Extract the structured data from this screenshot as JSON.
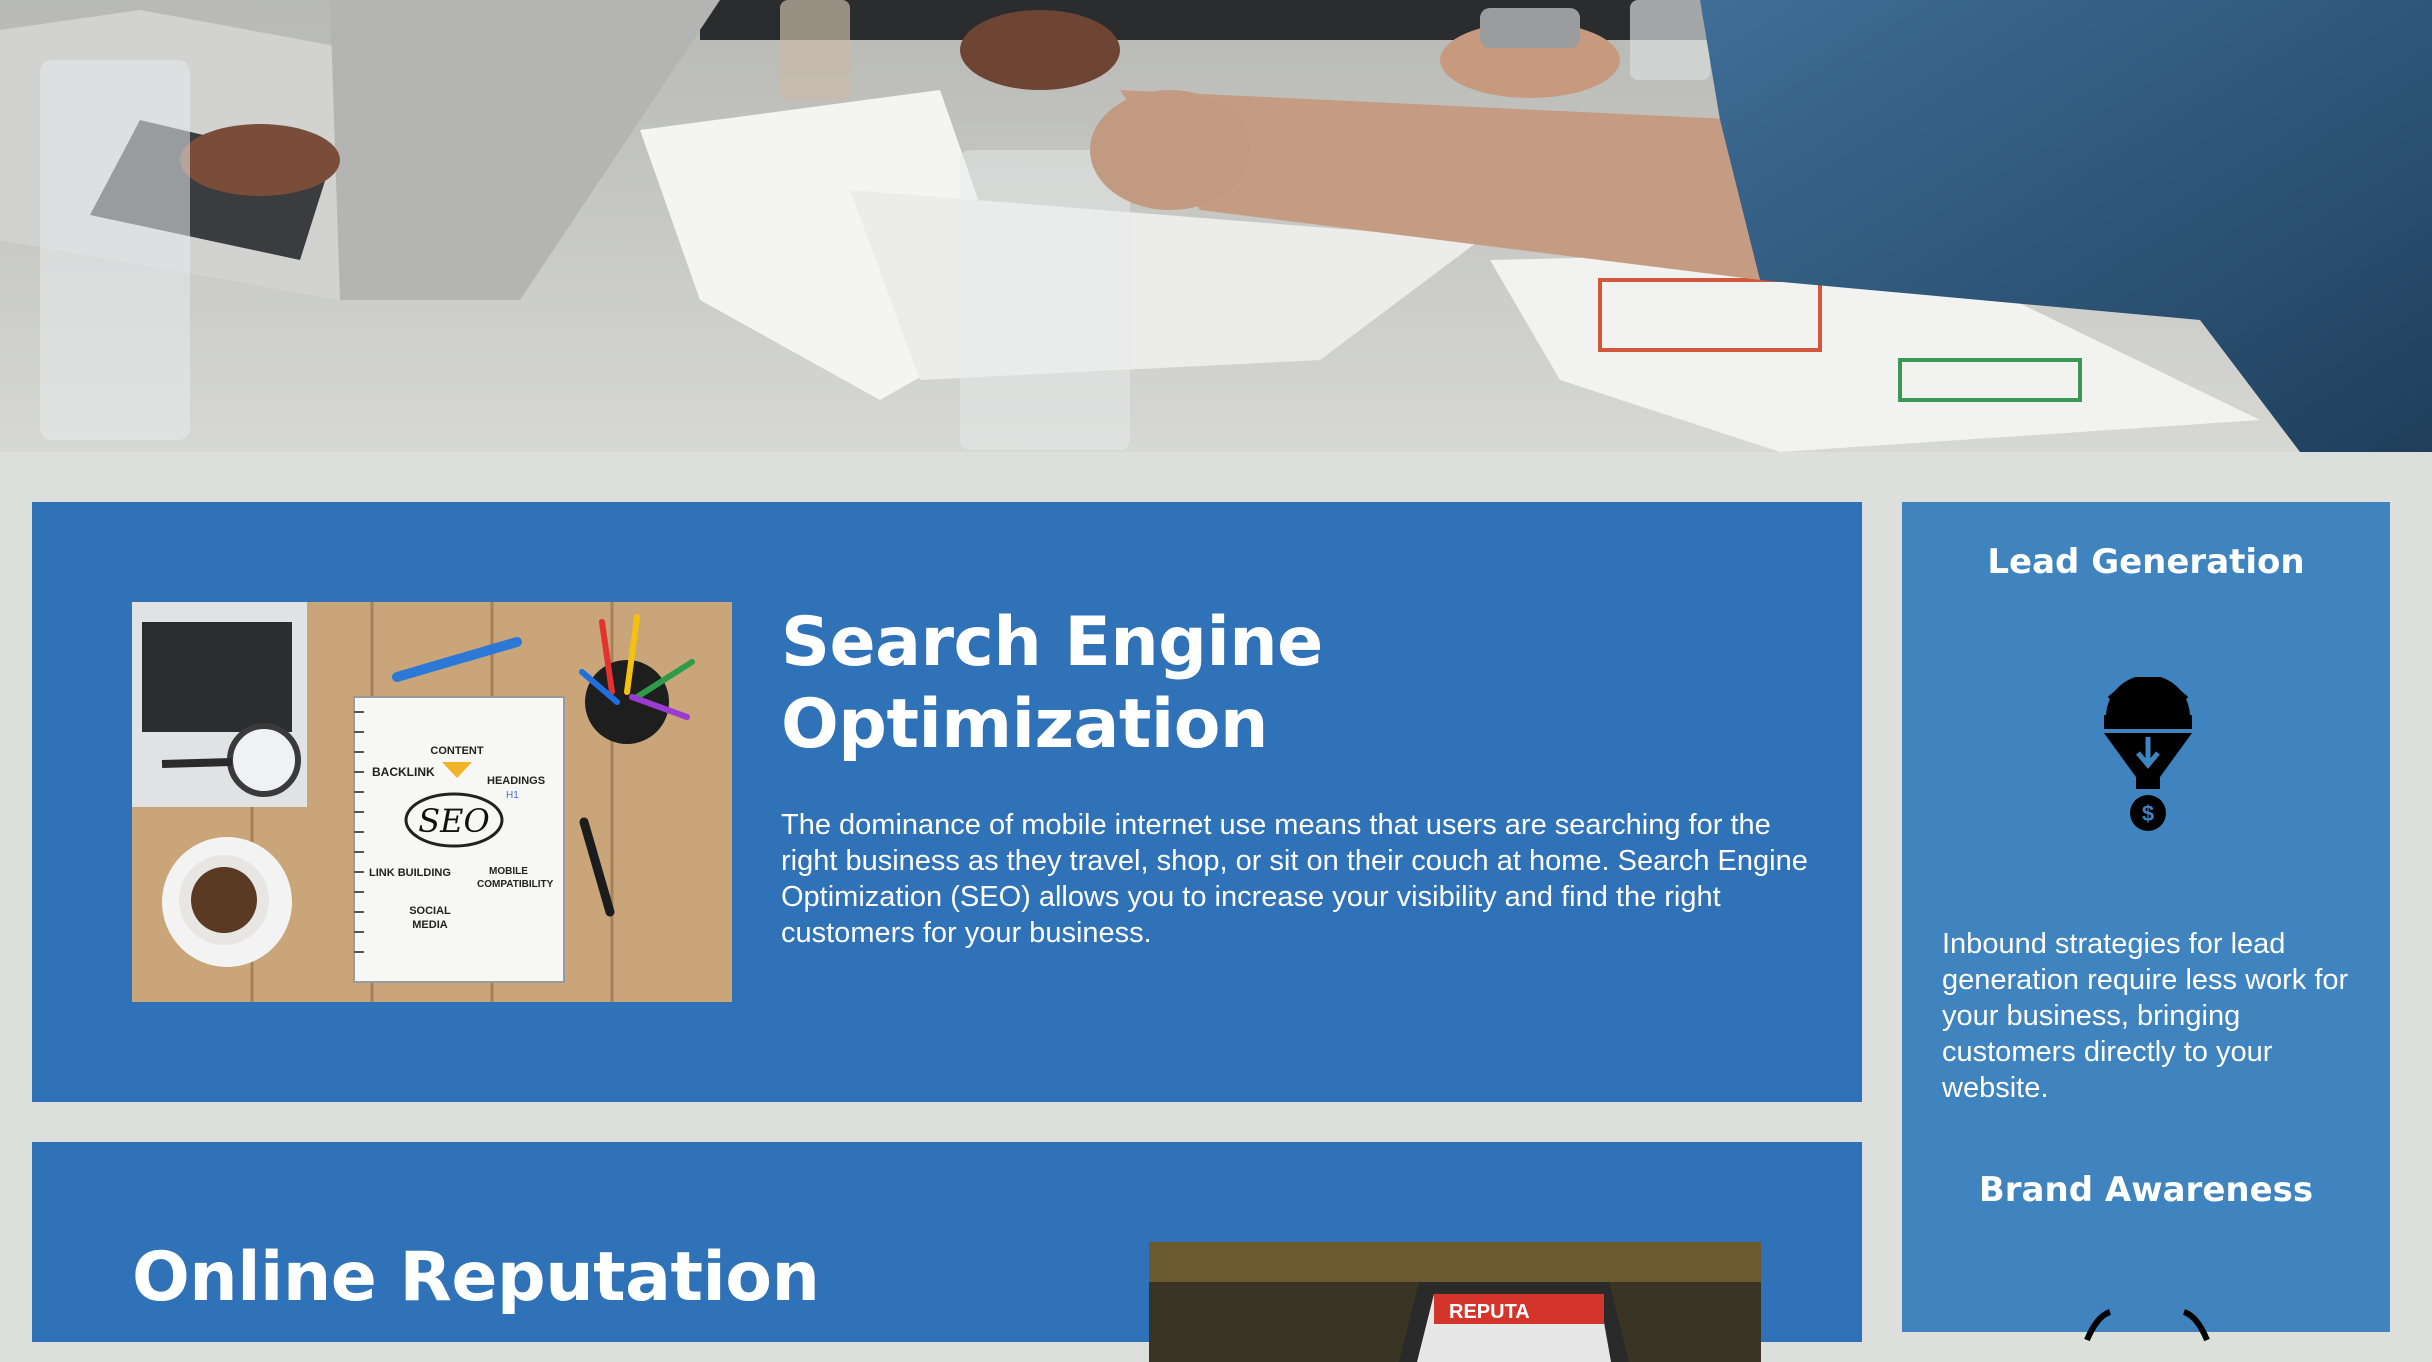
{
  "hero": {
    "alt_subject": ""
  },
  "seo_card": {
    "title": "Search Engine Optimization",
    "body": "The dominance of mobile internet use means that users are searching for the right business as they travel, shop, or sit on their couch at home. Search Engine Optimization (SEO) allows you to increase your visibility and find the right customers for your business.",
    "image_labels": {
      "center": "SEO",
      "content": "CONTENT",
      "backlink": "BACKLINK",
      "headings": "HEADINGS",
      "h_tag": "H1",
      "link_building": "LINK BUILDING",
      "mobile": "MOBILE",
      "compat": "COMPATIBILITY",
      "social": "SOCIAL",
      "media": "MEDIA"
    }
  },
  "orm_card": {
    "title": "Online Reputation",
    "image_label": "REPUTA"
  },
  "sidebar": {
    "lead_heading": "Lead Generation",
    "lead_text": "Inbound strategies for lead generation require less work for your business, bringing customers directly to your website.",
    "lead_icon": "funnel-gear-dollar-icon",
    "brand_heading": "Brand Awareness",
    "dollar_symbol": "$"
  },
  "colors": {
    "page_bg": "#dcdfdb",
    "card_blue": "#2f72b7",
    "sidebar_blue": "#3f83bf",
    "text": "#ffffff"
  }
}
